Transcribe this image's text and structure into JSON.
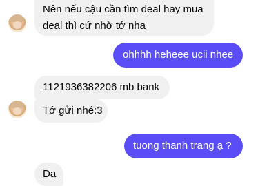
{
  "messages": [
    {
      "side": "incoming",
      "lines": [
        "Nên nếu cậu cần tìm deal hay mua",
        "deal thì cứ nhờ tớ nha"
      ]
    },
    {
      "side": "outgoing",
      "text": "ohhhh heheee ucii nhee"
    },
    {
      "side": "incoming",
      "account_number": "1121936382206",
      "bank": " mb bank"
    },
    {
      "side": "incoming",
      "text": "Tớ gửi nhé:3"
    },
    {
      "side": "outgoing",
      "text": "tuong thanh trang ạ ?"
    },
    {
      "side": "incoming",
      "text": "Da"
    }
  ],
  "icons": {
    "sender_avatar": "avatar-icon"
  },
  "colors": {
    "incoming_bubble": "#f0f0f0",
    "outgoing_bubble": "#5b4df5",
    "incoming_text": "#050505",
    "outgoing_text": "#ffffff"
  }
}
